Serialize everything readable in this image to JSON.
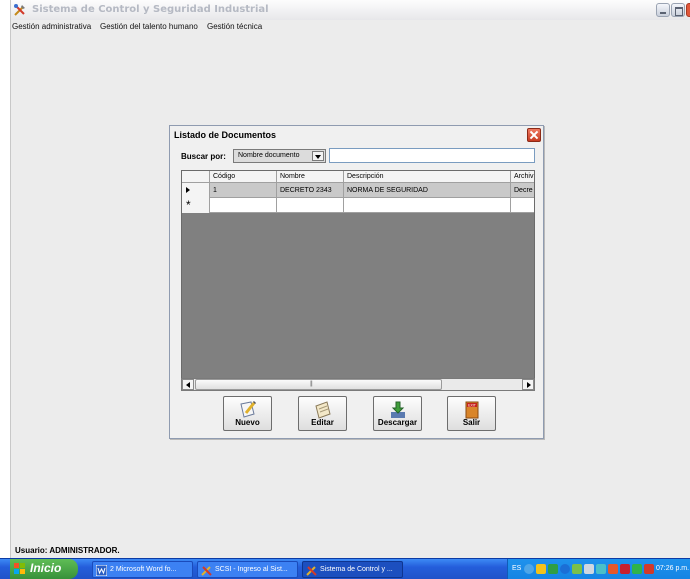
{
  "window": {
    "title": "Sistema de Control y Seguridad Industrial",
    "icon": "tools-icon"
  },
  "menu": {
    "items": [
      "Gestión administrativa",
      "Gestión del talento humano",
      "Gestión técnica"
    ]
  },
  "dialog": {
    "title": "Listado de Documentos",
    "search_label": "Buscar por:",
    "search_field_value": "Nombre documento",
    "search_input_value": "",
    "columns": [
      "Código",
      "Nombre",
      "Descripción",
      "Archiv"
    ],
    "rows": [
      {
        "codigo": "1",
        "nombre": "DECRETO 2343",
        "descripcion": "NORMA DE SEGURIDAD",
        "archivo": "Decre"
      }
    ],
    "buttons": {
      "nuevo": "Nuevo",
      "editar": "Editar",
      "descargar": "Descargar",
      "salir": "Salir",
      "salir_icon_text": "EXIT"
    }
  },
  "status_bar": {
    "user_text": "Usuario: ADMINISTRADOR."
  },
  "taskbar": {
    "start_label": "Inicio",
    "tasks": [
      "2 Microsoft Word fo...",
      "SCSI - Ingreso al Sist...",
      "Sistema de Control y ..."
    ],
    "language": "ES",
    "clock": "07:26 p.m."
  },
  "colors": {
    "grid_background": "#808080",
    "selected_row": "#c9c9c9",
    "taskbar": "#245edb",
    "start_button": "#37913a",
    "close_button": "#c63b22"
  }
}
